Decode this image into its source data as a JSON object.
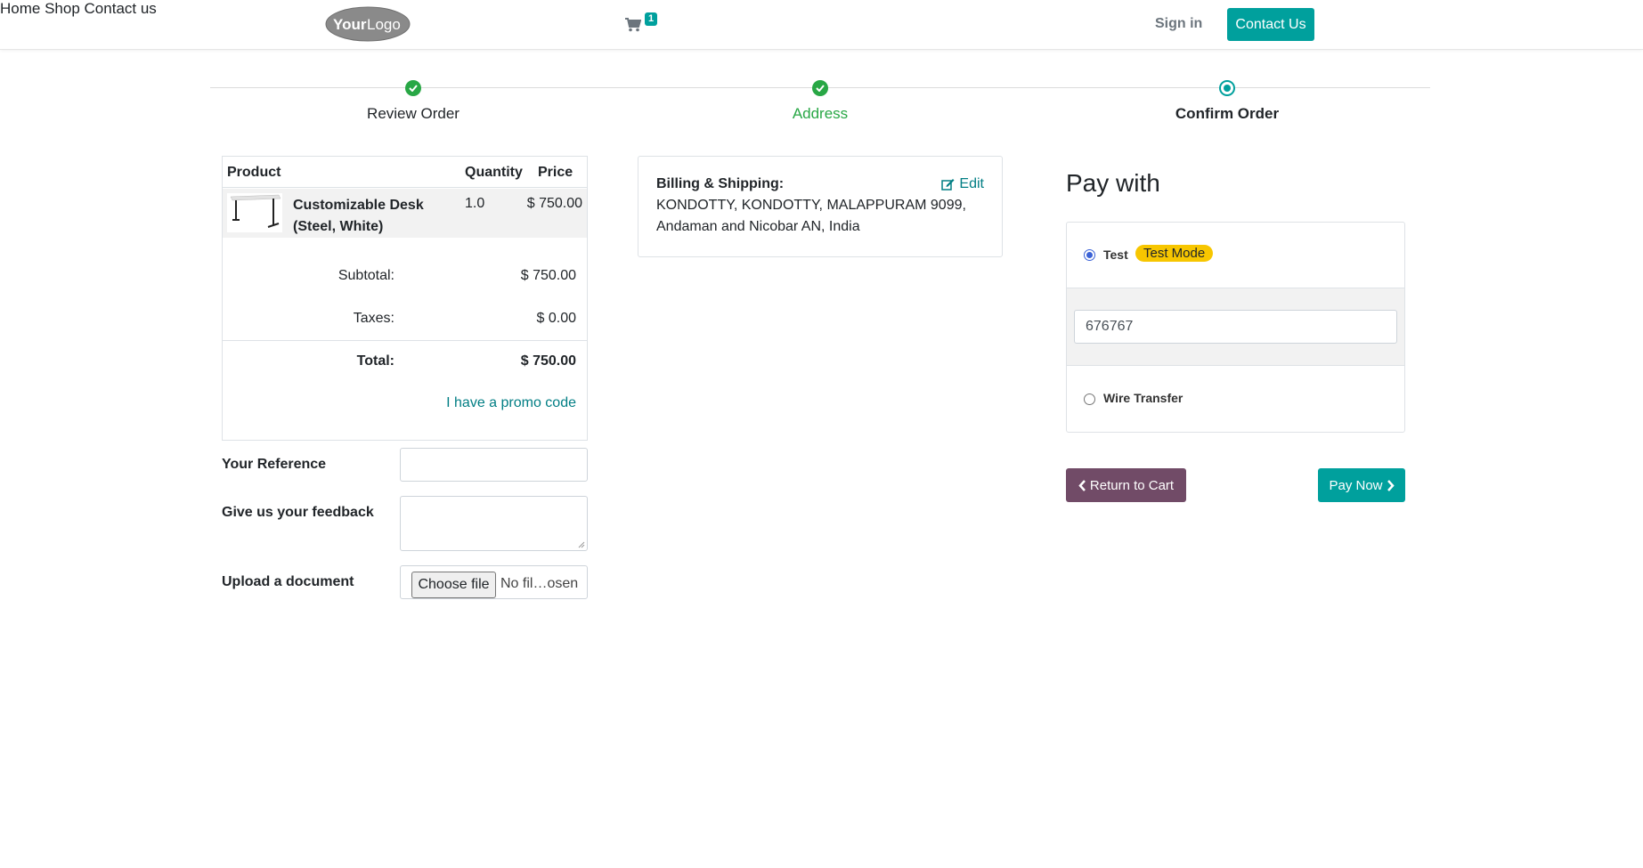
{
  "header": {
    "logo_text": "YourLogo",
    "nav": [
      "Home",
      "Shop",
      "Contact us"
    ],
    "cart_count": "1",
    "signin": "Sign in",
    "contact_btn": "Contact Us"
  },
  "wizard": {
    "steps": [
      {
        "label": "Review Order",
        "state": "done"
      },
      {
        "label": "Address",
        "state": "done"
      },
      {
        "label": "Confirm Order",
        "state": "current"
      }
    ],
    "colors": {
      "done": "#28a745",
      "current": "#00a09d"
    }
  },
  "order": {
    "headers": {
      "product": "Product",
      "quantity": "Quantity",
      "price": "Price"
    },
    "line": {
      "name_line1": "Customizable Desk",
      "name_line2": "(Steel, White)",
      "quantity": "1.0",
      "price": "$ 750.00"
    },
    "subtotal_label": "Subtotal:",
    "subtotal": "$ 750.00",
    "taxes_label": "Taxes:",
    "taxes": "$ 0.00",
    "total_label": "Total:",
    "total": "$ 750.00",
    "promo": "I have a promo code"
  },
  "form": {
    "reference_label": "Your Reference",
    "feedback_label": "Give us your feedback",
    "upload_label": "Upload a document",
    "file_button": "Choose file",
    "file_status": "No fil…osen"
  },
  "address": {
    "title": "Billing & Shipping:",
    "edit": "Edit",
    "line1": "KONDOTTY, KONDOTTY, MALAPPURAM 9099,",
    "line2": "Andaman and Nicobar AN, India"
  },
  "payment": {
    "title": "Pay with",
    "option1": "Test",
    "option1_badge": "Test Mode",
    "token_value": "676767",
    "option2": "Wire Transfer",
    "return_btn": "Return to Cart",
    "pay_btn": "Pay Now"
  }
}
